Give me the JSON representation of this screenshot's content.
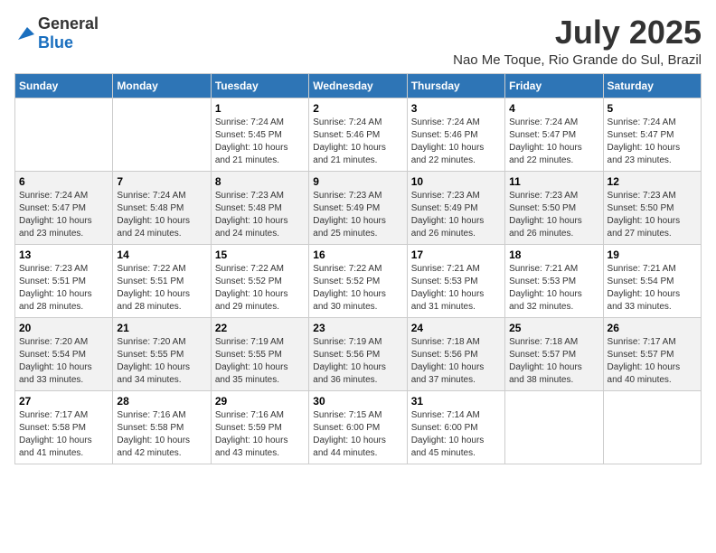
{
  "logo": {
    "text_general": "General",
    "text_blue": "Blue"
  },
  "title": "July 2025",
  "subtitle": "Nao Me Toque, Rio Grande do Sul, Brazil",
  "headers": [
    "Sunday",
    "Monday",
    "Tuesday",
    "Wednesday",
    "Thursday",
    "Friday",
    "Saturday"
  ],
  "weeks": [
    [
      null,
      null,
      {
        "day": "1",
        "sunrise": "7:24 AM",
        "sunset": "5:45 PM",
        "daylight": "10 hours and 21 minutes."
      },
      {
        "day": "2",
        "sunrise": "7:24 AM",
        "sunset": "5:46 PM",
        "daylight": "10 hours and 21 minutes."
      },
      {
        "day": "3",
        "sunrise": "7:24 AM",
        "sunset": "5:46 PM",
        "daylight": "10 hours and 22 minutes."
      },
      {
        "day": "4",
        "sunrise": "7:24 AM",
        "sunset": "5:47 PM",
        "daylight": "10 hours and 22 minutes."
      },
      {
        "day": "5",
        "sunrise": "7:24 AM",
        "sunset": "5:47 PM",
        "daylight": "10 hours and 23 minutes."
      }
    ],
    [
      {
        "day": "6",
        "sunrise": "7:24 AM",
        "sunset": "5:47 PM",
        "daylight": "10 hours and 23 minutes."
      },
      {
        "day": "7",
        "sunrise": "7:24 AM",
        "sunset": "5:48 PM",
        "daylight": "10 hours and 24 minutes."
      },
      {
        "day": "8",
        "sunrise": "7:23 AM",
        "sunset": "5:48 PM",
        "daylight": "10 hours and 24 minutes."
      },
      {
        "day": "9",
        "sunrise": "7:23 AM",
        "sunset": "5:49 PM",
        "daylight": "10 hours and 25 minutes."
      },
      {
        "day": "10",
        "sunrise": "7:23 AM",
        "sunset": "5:49 PM",
        "daylight": "10 hours and 26 minutes."
      },
      {
        "day": "11",
        "sunrise": "7:23 AM",
        "sunset": "5:50 PM",
        "daylight": "10 hours and 26 minutes."
      },
      {
        "day": "12",
        "sunrise": "7:23 AM",
        "sunset": "5:50 PM",
        "daylight": "10 hours and 27 minutes."
      }
    ],
    [
      {
        "day": "13",
        "sunrise": "7:23 AM",
        "sunset": "5:51 PM",
        "daylight": "10 hours and 28 minutes."
      },
      {
        "day": "14",
        "sunrise": "7:22 AM",
        "sunset": "5:51 PM",
        "daylight": "10 hours and 28 minutes."
      },
      {
        "day": "15",
        "sunrise": "7:22 AM",
        "sunset": "5:52 PM",
        "daylight": "10 hours and 29 minutes."
      },
      {
        "day": "16",
        "sunrise": "7:22 AM",
        "sunset": "5:52 PM",
        "daylight": "10 hours and 30 minutes."
      },
      {
        "day": "17",
        "sunrise": "7:21 AM",
        "sunset": "5:53 PM",
        "daylight": "10 hours and 31 minutes."
      },
      {
        "day": "18",
        "sunrise": "7:21 AM",
        "sunset": "5:53 PM",
        "daylight": "10 hours and 32 minutes."
      },
      {
        "day": "19",
        "sunrise": "7:21 AM",
        "sunset": "5:54 PM",
        "daylight": "10 hours and 33 minutes."
      }
    ],
    [
      {
        "day": "20",
        "sunrise": "7:20 AM",
        "sunset": "5:54 PM",
        "daylight": "10 hours and 33 minutes."
      },
      {
        "day": "21",
        "sunrise": "7:20 AM",
        "sunset": "5:55 PM",
        "daylight": "10 hours and 34 minutes."
      },
      {
        "day": "22",
        "sunrise": "7:19 AM",
        "sunset": "5:55 PM",
        "daylight": "10 hours and 35 minutes."
      },
      {
        "day": "23",
        "sunrise": "7:19 AM",
        "sunset": "5:56 PM",
        "daylight": "10 hours and 36 minutes."
      },
      {
        "day": "24",
        "sunrise": "7:18 AM",
        "sunset": "5:56 PM",
        "daylight": "10 hours and 37 minutes."
      },
      {
        "day": "25",
        "sunrise": "7:18 AM",
        "sunset": "5:57 PM",
        "daylight": "10 hours and 38 minutes."
      },
      {
        "day": "26",
        "sunrise": "7:17 AM",
        "sunset": "5:57 PM",
        "daylight": "10 hours and 40 minutes."
      }
    ],
    [
      {
        "day": "27",
        "sunrise": "7:17 AM",
        "sunset": "5:58 PM",
        "daylight": "10 hours and 41 minutes."
      },
      {
        "day": "28",
        "sunrise": "7:16 AM",
        "sunset": "5:58 PM",
        "daylight": "10 hours and 42 minutes."
      },
      {
        "day": "29",
        "sunrise": "7:16 AM",
        "sunset": "5:59 PM",
        "daylight": "10 hours and 43 minutes."
      },
      {
        "day": "30",
        "sunrise": "7:15 AM",
        "sunset": "6:00 PM",
        "daylight": "10 hours and 44 minutes."
      },
      {
        "day": "31",
        "sunrise": "7:14 AM",
        "sunset": "6:00 PM",
        "daylight": "10 hours and 45 minutes."
      },
      null,
      null
    ]
  ]
}
